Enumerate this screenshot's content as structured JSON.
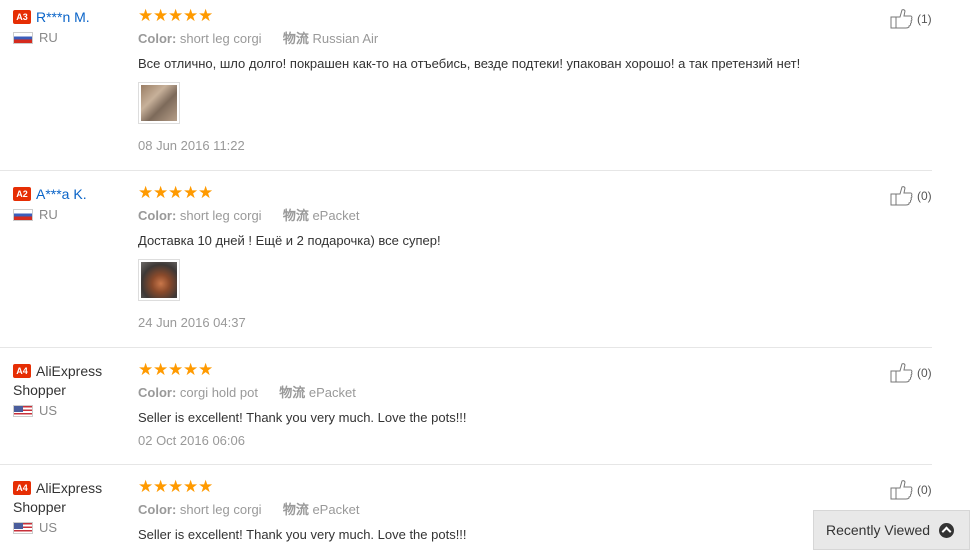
{
  "reviews": [
    {
      "level": "A3",
      "user": "R***n M.",
      "country": "RU",
      "color_label": "Color:",
      "color_value": "short leg corgi",
      "shipping_label": "物流",
      "shipping_value": "Russian Air",
      "text": "Все отлично, шло долго! покрашен как-то на отъебись, везде подтеки! упакован хорошо! а так претензий нет!",
      "date": "08 Jun 2016 11:22",
      "helpful": "(1)",
      "stars": 5
    },
    {
      "level": "A2",
      "user": "A***a K.",
      "country": "RU",
      "color_label": "Color:",
      "color_value": "short leg corgi",
      "shipping_label": "物流",
      "shipping_value": "ePacket",
      "text": "Доставка 10 дней ! Ещё и 2 подарочка) все супер!",
      "date": "24 Jun 2016 04:37",
      "helpful": "(0)",
      "stars": 5
    },
    {
      "level": "A4",
      "user": "AliExpress Shopper",
      "country": "US",
      "color_label": "Color:",
      "color_value": "corgi hold pot",
      "shipping_label": "物流",
      "shipping_value": "ePacket",
      "text": "Seller is excellent! Thank you very much. Love the pots!!!",
      "date": "02 Oct 2016 06:06",
      "helpful": "(0)",
      "stars": 5
    },
    {
      "level": "A4",
      "user": "AliExpress Shopper",
      "country": "US",
      "color_label": "Color:",
      "color_value": "short leg corgi",
      "shipping_label": "物流",
      "shipping_value": "ePacket",
      "text": "Seller is excellent! Thank you very much. Love the pots!!!",
      "date": "",
      "helpful": "(0)",
      "stars": 5
    }
  ],
  "recently_viewed": "Recently Viewed",
  "colors": {
    "star": "#ff9a00",
    "badge": "#e62e04",
    "link": "#0a64c8"
  },
  "icons": [
    "thumbs-up-icon",
    "flag-ru-icon",
    "flag-us-icon",
    "chevron-up-icon"
  ]
}
